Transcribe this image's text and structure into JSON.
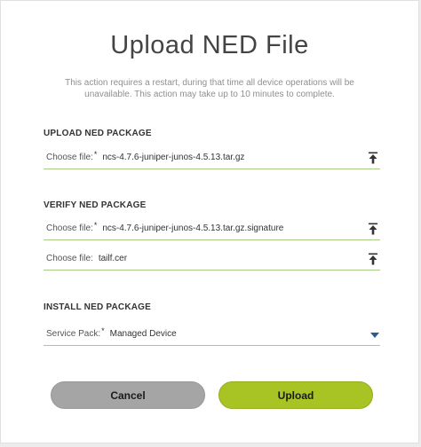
{
  "dialog": {
    "title": "Upload NED File",
    "subtitle": "This action requires a restart, during that time all device operations will be unavailable. This action may take up to 10 minutes to complete."
  },
  "upload_section": {
    "title": "UPLOAD NED PACKAGE",
    "file_field": {
      "label": "Choose file:",
      "required_mark": "*",
      "value": "ncs-4.7.6-juniper-junos-4.5.13.tar.gz"
    }
  },
  "verify_section": {
    "title": "VERIFY NED PACKAGE",
    "signature_field": {
      "label": "Choose file:",
      "required_mark": "*",
      "value": "ncs-4.7.6-juniper-junos-4.5.13.tar.gz.signature"
    },
    "cert_field": {
      "label": "Choose file:",
      "value": "tailf.cer"
    }
  },
  "install_section": {
    "title": "INSTALL NED PACKAGE",
    "service_pack_field": {
      "label": "Service Pack:",
      "required_mark": "*",
      "value": "Managed Device"
    }
  },
  "buttons": {
    "cancel": "Cancel",
    "upload": "Upload"
  },
  "icons": {
    "upload": "upload-icon",
    "dropdown": "chevron-down-icon"
  },
  "colors": {
    "accent": "#a8c424",
    "underline": "#a9cc86",
    "cancel": "#a5a5a5",
    "dropdown_arrow": "#2b5d8c"
  }
}
